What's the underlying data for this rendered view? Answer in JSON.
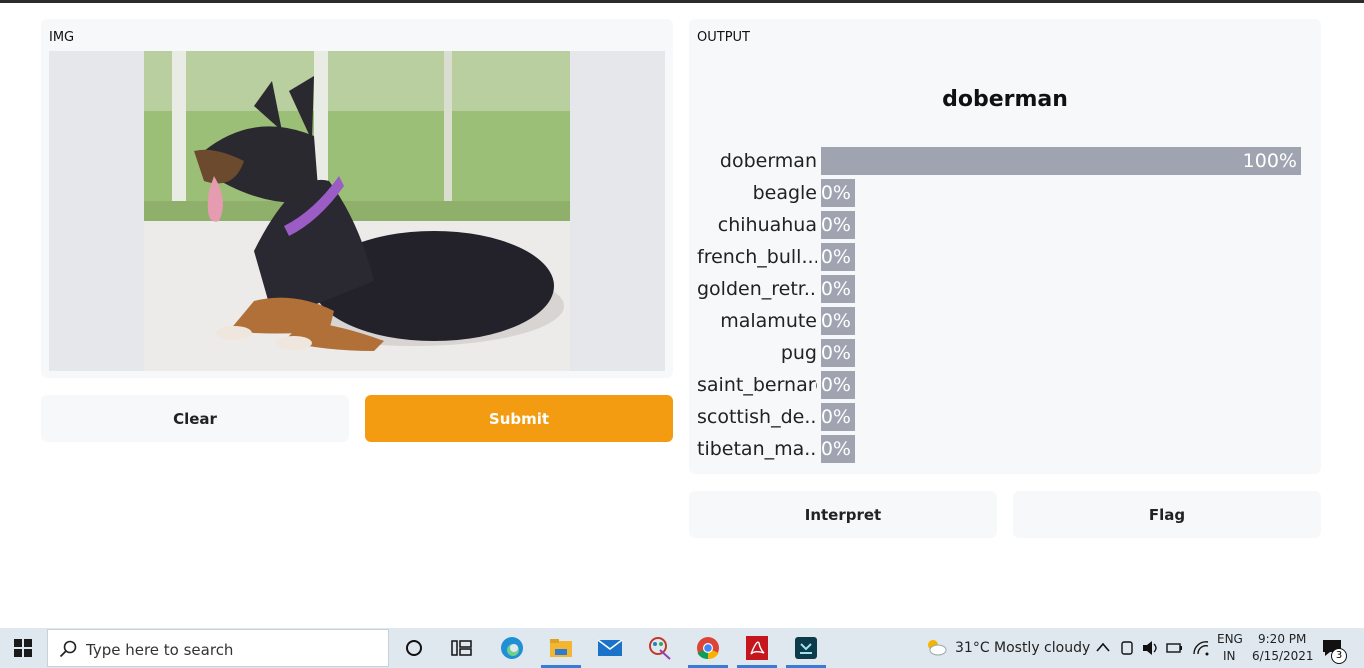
{
  "input_panel": {
    "label": "IMG"
  },
  "buttons": {
    "clear": "Clear",
    "submit": "Submit",
    "interpret": "Interpret",
    "flag": "Flag"
  },
  "output_panel": {
    "label": "OUTPUT",
    "top_prediction": "doberman",
    "predictions": [
      {
        "label": "doberman",
        "percent_text": "100%",
        "value": 1.0
      },
      {
        "label": "beagle",
        "percent_text": "0%",
        "value": 0
      },
      {
        "label": "chihuahua",
        "percent_text": "0%",
        "value": 0
      },
      {
        "label": "french_bull...",
        "percent_text": "0%",
        "value": 0
      },
      {
        "label": "golden_retr...",
        "percent_text": "0%",
        "value": 0
      },
      {
        "label": "malamute",
        "percent_text": "0%",
        "value": 0
      },
      {
        "label": "pug",
        "percent_text": "0%",
        "value": 0
      },
      {
        "label": "saint_bernard",
        "percent_text": "0%",
        "value": 0
      },
      {
        "label": "scottish_de...",
        "percent_text": "0%",
        "value": 0
      },
      {
        "label": "tibetan_ma...",
        "percent_text": "0%",
        "value": 0
      }
    ]
  },
  "taskbar": {
    "search_placeholder": "Type here to search",
    "weather": "31°C",
    "weather_desc": "Mostly cloudy",
    "lang_top": "ENG",
    "lang_bottom": "IN",
    "time": "9:20 PM",
    "date": "6/15/2021",
    "notification_count": "3",
    "icons": [
      "windows-start-icon",
      "search-icon",
      "cortana-icon",
      "task-view-icon",
      "edge-icon",
      "file-explorer-icon",
      "mail-icon",
      "paint-icon",
      "chrome-icon",
      "acrobat-icon",
      "app-icon"
    ]
  },
  "colors": {
    "submit": "#f39c12",
    "bar": "#a0a4b0",
    "panel": "#f7f8fa"
  }
}
